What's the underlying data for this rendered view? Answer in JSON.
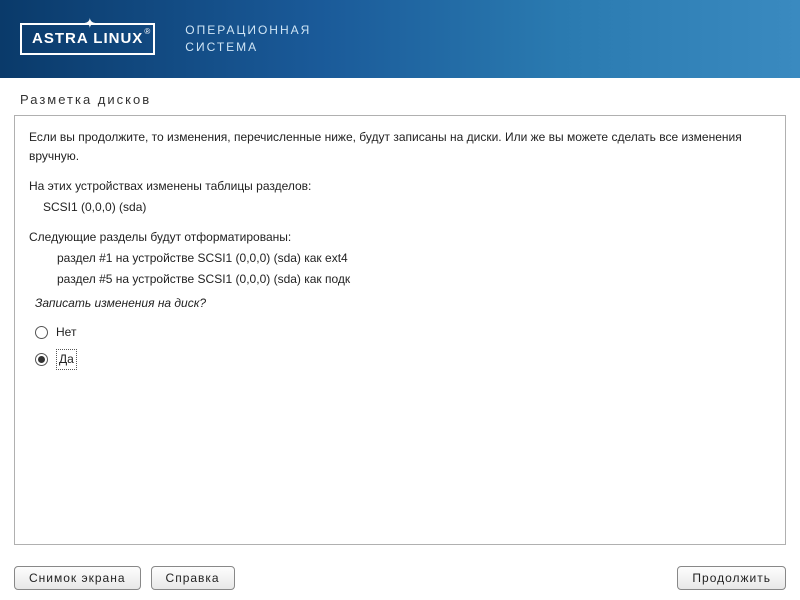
{
  "header": {
    "logo": "ASTRA LINUX",
    "subtitle_line1": "ОПЕРАЦИОННАЯ",
    "subtitle_line2": "СИСТЕМА"
  },
  "page_title": "Разметка дисков",
  "content": {
    "intro": "Если вы продолжите, то изменения, перечисленные ниже, будут записаны на диски. Или же вы можете сделать все изменения вручную.",
    "devices_heading": "На этих устройствах изменены таблицы разделов:",
    "device1": "SCSI1 (0,0,0) (sda)",
    "format_heading": "Следующие разделы будут отформатированы:",
    "partition1": "раздел #1 на устройстве SCSI1 (0,0,0) (sda) как ext4",
    "partition2": "раздел #5 на устройстве SCSI1 (0,0,0) (sda) как подк",
    "question": "Записать изменения на диск?"
  },
  "radios": {
    "no": "Нет",
    "yes": "Да",
    "selected": "yes"
  },
  "buttons": {
    "screenshot": "Снимок экрана",
    "help": "Справка",
    "continue": "Продолжить"
  }
}
